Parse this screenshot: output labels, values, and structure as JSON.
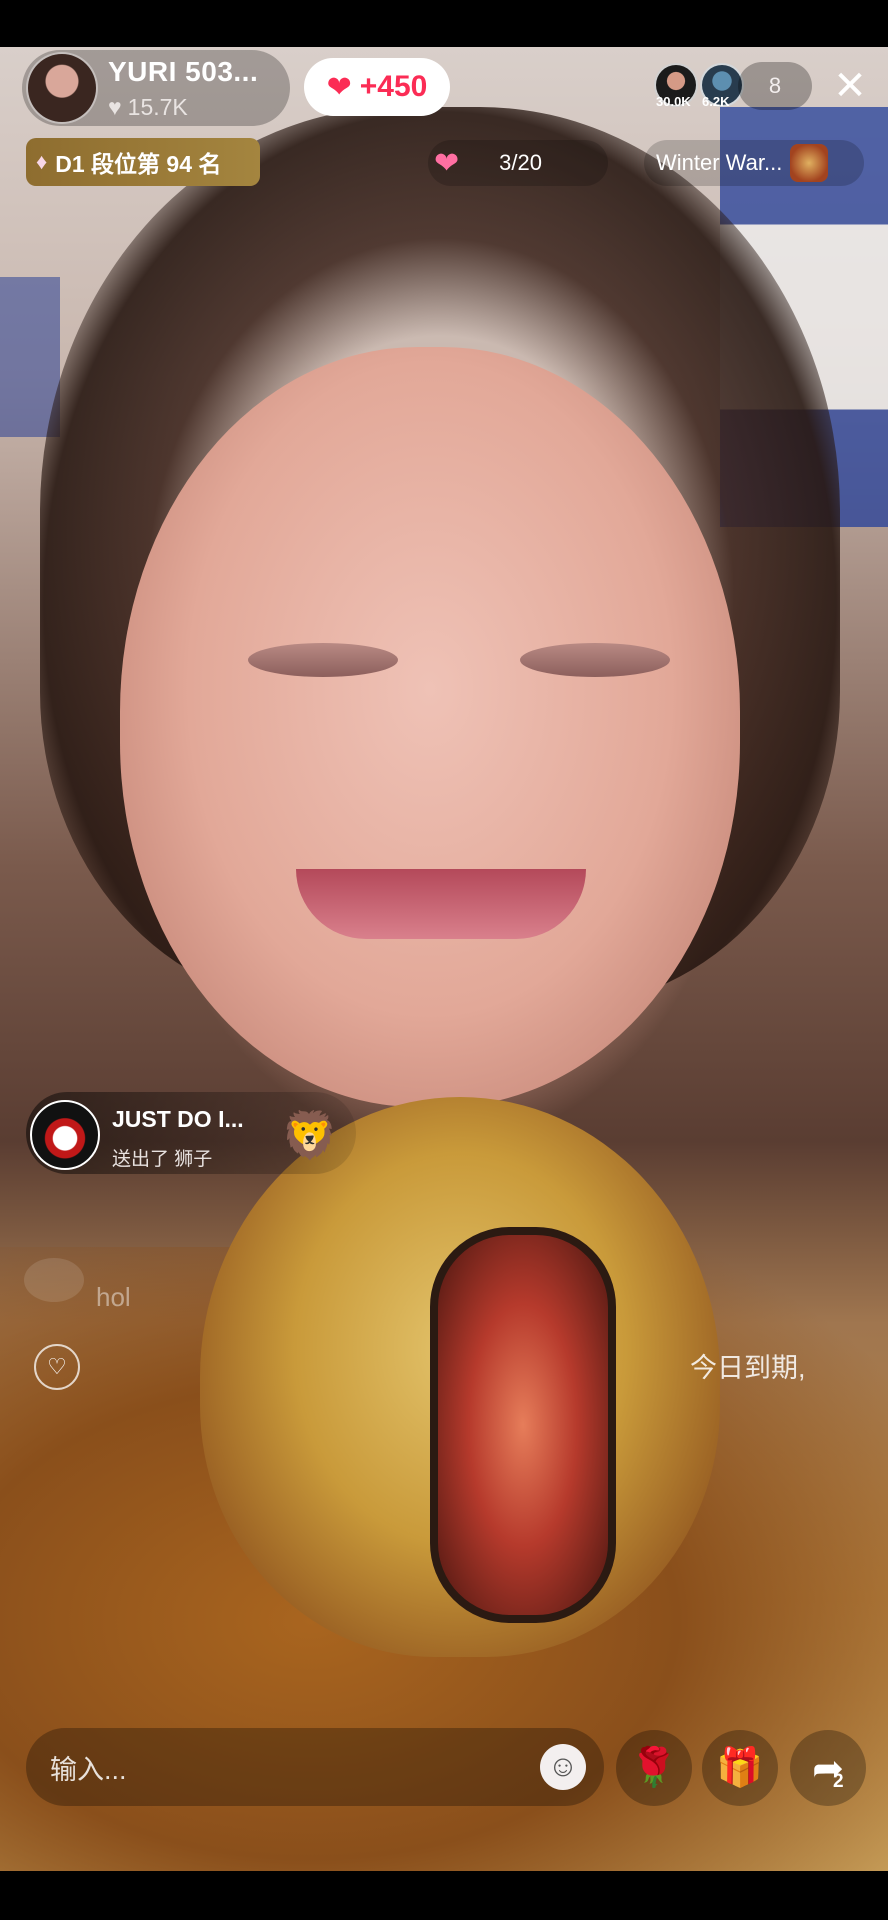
{
  "host": {
    "name": "YURI 503...",
    "likes": "15.7K",
    "rank": "D1 段位第 94 名"
  },
  "likes_gain": "+450",
  "viewers": {
    "top1_score": "30.0K",
    "top2_score": "6.2K",
    "count": "8"
  },
  "task": {
    "progress": "3/20"
  },
  "event": {
    "label": "Winter War..."
  },
  "gift_notification": {
    "user": "JUST DO I...",
    "action": "送出了 狮子",
    "gift_icon": "lion-gift-icon"
  },
  "chat": {
    "partial_text": "hol",
    "notice_partial": "今日到期,"
  },
  "bottom_bar": {
    "input_placeholder": "输入...",
    "share_count": "2"
  }
}
